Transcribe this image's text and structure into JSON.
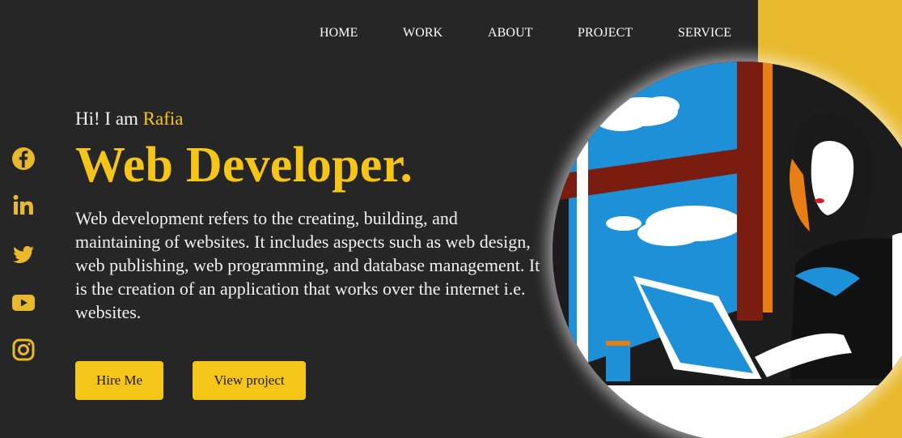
{
  "nav": {
    "items": [
      {
        "label": "HOME"
      },
      {
        "label": "WORK"
      },
      {
        "label": "ABOUT"
      },
      {
        "label": "PROJECT"
      },
      {
        "label": "SERVICE"
      }
    ]
  },
  "social": {
    "icons": [
      "facebook-icon",
      "linkedin-icon",
      "twitter-icon",
      "youtube-icon",
      "instagram-icon"
    ]
  },
  "hero": {
    "greeting_prefix": "Hi! I am",
    "name": "Rafia",
    "role": "Web Developer.",
    "description": "Web development refers to the creating, building, and maintaining of websites. It includes aspects such as web design, web publishing, web programming, and database management. It is the creation of an application that works over the internet i.e. websites.",
    "hire_button": "Hire Me",
    "view_button": "View project"
  },
  "colors": {
    "background": "#262626",
    "accent": "#f5c518",
    "panel": "#e8b92c",
    "text": "#ffffff"
  }
}
